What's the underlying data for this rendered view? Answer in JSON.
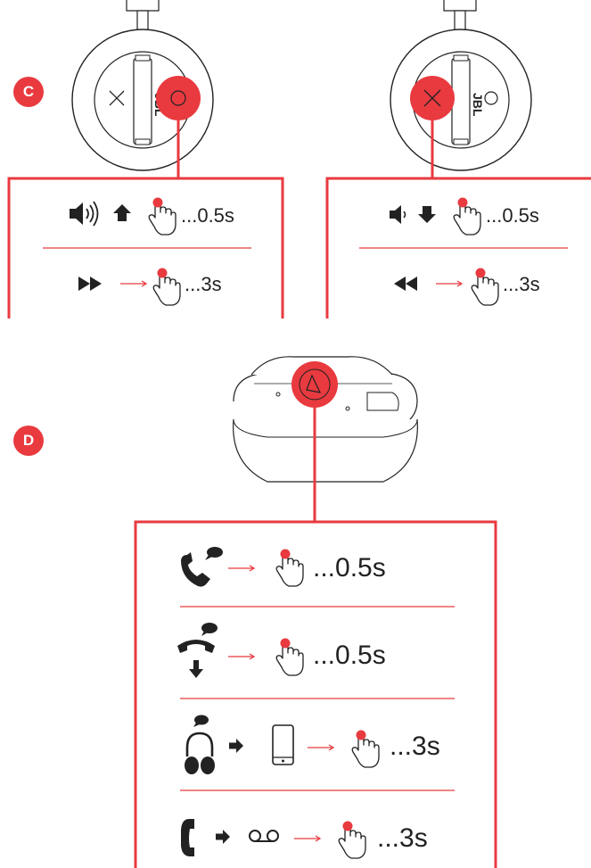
{
  "section_c": {
    "badge": "C",
    "left_panel": {
      "row1": {
        "duration": "...0.5s",
        "icons": [
          "volume-up-icon",
          "arrow-up-icon",
          "finger-press-icon"
        ]
      },
      "row2": {
        "duration": "...3s",
        "icons": [
          "fast-forward-icon",
          "arrow-right-icon",
          "finger-press-icon"
        ]
      }
    },
    "right_panel": {
      "row1": {
        "duration": "...0.5s",
        "icons": [
          "volume-down-icon",
          "arrow-down-icon",
          "finger-press-icon"
        ]
      },
      "row2": {
        "duration": "...3s",
        "icons": [
          "rewind-icon",
          "arrow-right-icon",
          "finger-press-icon"
        ]
      }
    }
  },
  "section_d": {
    "badge": "D",
    "rows": [
      {
        "duration": "...0.5s",
        "icons": [
          "answer-call-icon",
          "arrow-right-icon",
          "finger-press-icon"
        ]
      },
      {
        "duration": "...0.5s",
        "icons": [
          "end-call-icon",
          "arrow-right-icon",
          "finger-press-icon"
        ]
      },
      {
        "duration": "...3s",
        "icons": [
          "headphones-icon",
          "arrow-right-icon",
          "phone-icon",
          "finger-press-icon"
        ]
      },
      {
        "duration": "...3s",
        "icons": [
          "phone-handset-icon",
          "arrow-right-icon",
          "voicemail-icon",
          "finger-press-icon"
        ]
      }
    ]
  },
  "colors": {
    "accent": "#e83a3f",
    "line": "#e83a3f",
    "ink": "#222222"
  }
}
